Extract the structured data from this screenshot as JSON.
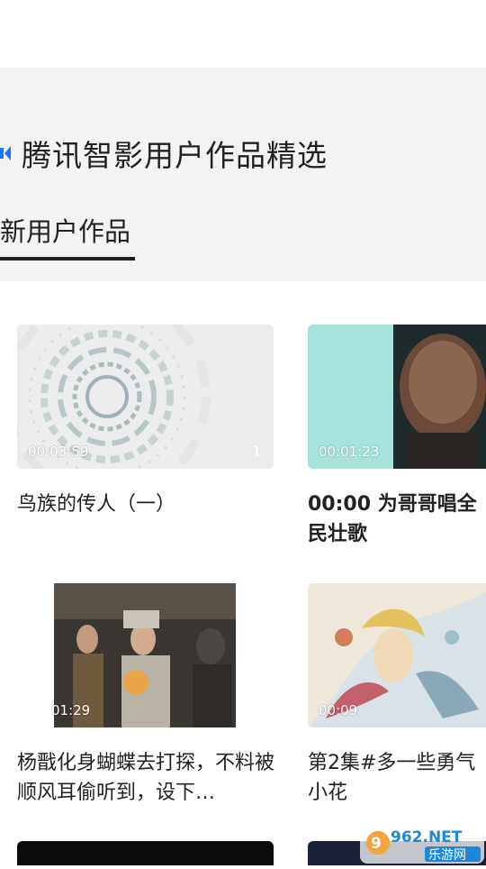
{
  "section": {
    "title": "腾讯智影用户作品精选",
    "tab_label": "新用户作品"
  },
  "cards": [
    {
      "duration": "00:03:59",
      "count": "1",
      "title": "鸟族的传人（一）"
    },
    {
      "duration": "00:01:23",
      "count": "",
      "title": "00:00 为哥哥唱全民壮歌"
    },
    {
      "duration": "01:29",
      "count": "",
      "title": "杨戬化身蝴蝶去打探，不料被顺风耳偷听到，设下…"
    },
    {
      "duration": "00:09",
      "count": "",
      "title": "第2集#多一些勇气小花"
    }
  ],
  "watermark": {
    "top": "962.NET",
    "bottom": "乐游网"
  },
  "colors": {
    "page_bg": "#ffffff",
    "panel_bg": "#f3f3f3",
    "accent": "#1677ff",
    "text": "#222222"
  }
}
